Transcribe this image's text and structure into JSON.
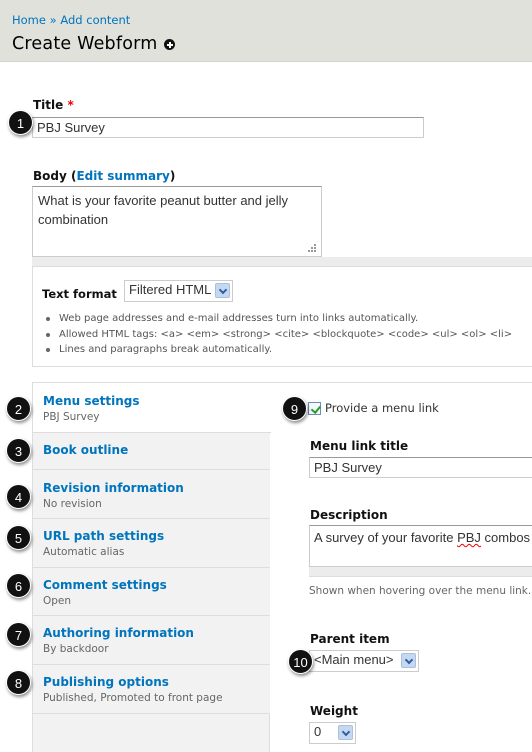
{
  "header": {
    "breadcrumb": [
      {
        "label": "Home"
      },
      {
        "separator": "»"
      },
      {
        "label": "Add content"
      }
    ],
    "title": "Create Webform",
    "add_shortcut_icon": "plus-circle-icon"
  },
  "title_field": {
    "label": "Title",
    "required_mark": "*",
    "value": "PBJ Survey"
  },
  "body_field": {
    "label_prefix": "Body (",
    "edit_summary_link": "Edit summary",
    "label_suffix": ")",
    "value": "What is your favorite peanut butter and jelly combination"
  },
  "text_format": {
    "label": "Text format",
    "selected": "Filtered HTML",
    "tips": [
      "Web page addresses and e-mail addresses turn into links automatically.",
      "Allowed HTML tags: <a> <em> <strong> <cite> <blockquote> <code> <ul> <ol> <li>",
      "Lines and paragraphs break automatically."
    ]
  },
  "vertical_tabs": [
    {
      "title": "Menu settings",
      "summary": "PBJ Survey",
      "active": true
    },
    {
      "title": "Book outline",
      "summary": ""
    },
    {
      "title": "Revision information",
      "summary": "No revision"
    },
    {
      "title": "URL path settings",
      "summary": "Automatic alias"
    },
    {
      "title": "Comment settings",
      "summary": "Open"
    },
    {
      "title": "Authoring information",
      "summary": "By backdoor"
    },
    {
      "title": "Publishing options",
      "summary": "Published, Promoted to front page"
    }
  ],
  "menu_panel": {
    "provide_menu_link_label": "Provide a menu link",
    "provide_menu_link_checked": true,
    "menu_link_title_label": "Menu link title",
    "menu_link_title_value": "PBJ Survey",
    "description_label": "Description",
    "description_value_before": "A survey of your favorite ",
    "description_value_misspelled": "PBJ",
    "description_value_after": " combos",
    "description_help": "Shown when hovering over the menu link.",
    "parent_item_label": "Parent item",
    "parent_item_selected": "<Main menu>",
    "weight_label": "Weight",
    "weight_selected": "0"
  },
  "callouts": [
    "1",
    "2",
    "3",
    "4",
    "5",
    "6",
    "7",
    "8",
    "9",
    "10"
  ],
  "colors": {
    "link": "#0074bd",
    "header_bg": "#e1e1dc",
    "required": "#ee0000",
    "tab_bg": "#f2f2f2"
  }
}
